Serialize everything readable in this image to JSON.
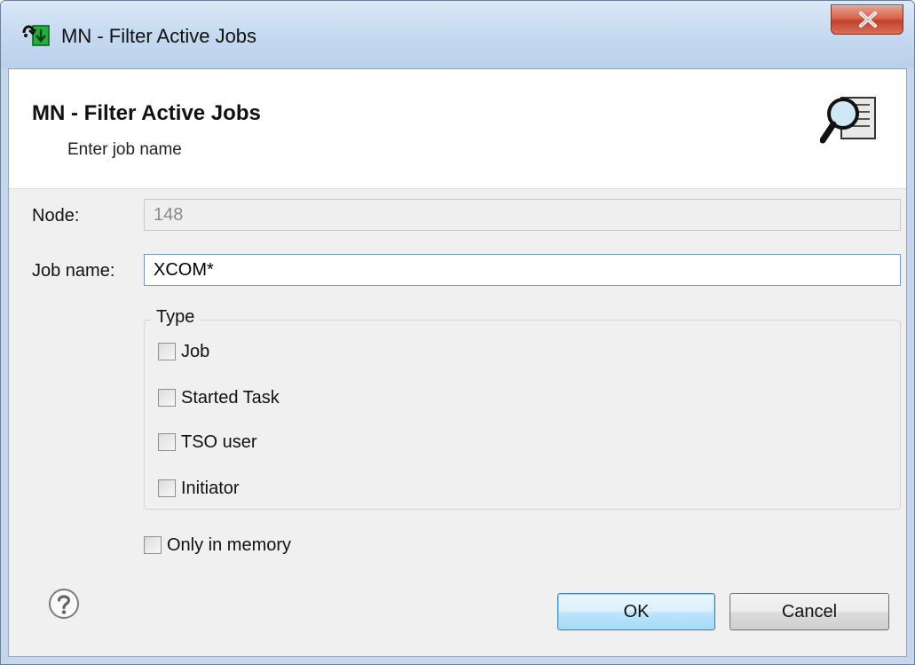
{
  "window": {
    "title": "MN - Filter Active Jobs"
  },
  "banner": {
    "title": "MN - Filter Active Jobs",
    "subtitle": "Enter job name"
  },
  "form": {
    "node_label": "Node:",
    "node_value": "148",
    "job_name_label": "Job name:",
    "job_name_value": "XCOM*"
  },
  "type_group": {
    "legend": "Type",
    "options": [
      {
        "label": "Job",
        "checked": false
      },
      {
        "label": "Started Task",
        "checked": false
      },
      {
        "label": "TSO user",
        "checked": false
      },
      {
        "label": "Initiator",
        "checked": false
      }
    ]
  },
  "only_in_memory": {
    "label": "Only in memory",
    "checked": false
  },
  "buttons": {
    "ok": "OK",
    "cancel": "Cancel"
  },
  "icons": {
    "app": "filter-jobs-app-icon",
    "banner": "magnifier-document-icon",
    "help": "help-icon",
    "close": "close-icon"
  },
  "colors": {
    "titlebar": "#c7dbf1",
    "close_button": "#c3412a",
    "dialog_background": "#f0f0f0",
    "default_button_border": "#3c7fb1"
  }
}
